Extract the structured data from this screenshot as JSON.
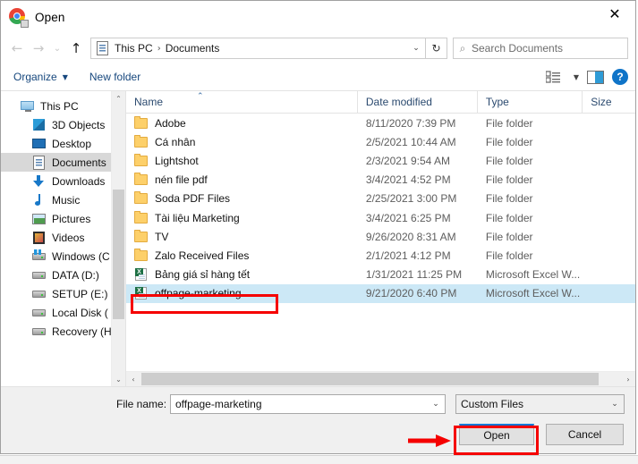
{
  "window": {
    "title": "Open",
    "app_icon": "chrome-icon",
    "close_label": "✕"
  },
  "nav": {
    "back_icon": "←",
    "forward_icon": "→",
    "recent_icon": "⌄",
    "up_icon": "↑",
    "address_icon": "documents-folder-icon",
    "breadcrumbs": [
      "This PC",
      "Documents"
    ],
    "separator": "›",
    "dropdown_caret": "⌄",
    "refresh_icon": "↻"
  },
  "search": {
    "icon": "⌕",
    "placeholder": "Search Documents"
  },
  "command_bar": {
    "organize_label": "Organize",
    "organize_caret": "▼",
    "new_folder_label": "New folder",
    "view_caret": "▼",
    "preview_pane_icon": "preview-pane-icon",
    "help_label": "?"
  },
  "sidebar": {
    "items": [
      {
        "label": "This PC",
        "icon": "pc-icon",
        "level": "root",
        "selected": false
      },
      {
        "label": "3D Objects",
        "icon": "3d-icon",
        "level": "child",
        "selected": false
      },
      {
        "label": "Desktop",
        "icon": "desktop-icon",
        "level": "child",
        "selected": false
      },
      {
        "label": "Documents",
        "icon": "documents-icon",
        "level": "child",
        "selected": true
      },
      {
        "label": "Downloads",
        "icon": "downloads-icon",
        "level": "child",
        "selected": false
      },
      {
        "label": "Music",
        "icon": "music-icon",
        "level": "child",
        "selected": false
      },
      {
        "label": "Pictures",
        "icon": "pictures-icon",
        "level": "child",
        "selected": false
      },
      {
        "label": "Videos",
        "icon": "videos-icon",
        "level": "child",
        "selected": false
      },
      {
        "label": "Windows (C",
        "icon": "windows-drive-icon",
        "level": "child",
        "selected": false
      },
      {
        "label": "DATA (D:)",
        "icon": "drive-icon",
        "level": "child",
        "selected": false
      },
      {
        "label": "SETUP (E:)",
        "icon": "drive-icon",
        "level": "child",
        "selected": false
      },
      {
        "label": "Local Disk (",
        "icon": "drive-icon",
        "level": "child",
        "selected": false
      },
      {
        "label": "Recovery (H",
        "icon": "drive-icon",
        "level": "child",
        "selected": false
      }
    ],
    "scroll_up_icon": "⌃",
    "scroll_down_icon": "⌄"
  },
  "file_list": {
    "columns": [
      "Name",
      "Date modified",
      "Type",
      "Size"
    ],
    "sort_caret": "⌃",
    "rows": [
      {
        "name": "Adobe",
        "date": "8/11/2020 7:39 PM",
        "type": "File folder",
        "size": "",
        "icon": "folder-icon",
        "selected": false
      },
      {
        "name": "Cá nhân",
        "date": "2/5/2021 10:44 AM",
        "type": "File folder",
        "size": "",
        "icon": "folder-icon",
        "selected": false
      },
      {
        "name": "Lightshot",
        "date": "2/3/2021 9:54 AM",
        "type": "File folder",
        "size": "",
        "icon": "folder-icon",
        "selected": false
      },
      {
        "name": "nén file pdf",
        "date": "3/4/2021 4:52 PM",
        "type": "File folder",
        "size": "",
        "icon": "folder-icon",
        "selected": false
      },
      {
        "name": "Soda PDF Files",
        "date": "2/25/2021 3:00 PM",
        "type": "File folder",
        "size": "",
        "icon": "folder-icon",
        "selected": false
      },
      {
        "name": "Tài liệu Marketing",
        "date": "3/4/2021 6:25 PM",
        "type": "File folder",
        "size": "",
        "icon": "folder-icon",
        "selected": false
      },
      {
        "name": "TV",
        "date": "9/26/2020 8:31 AM",
        "type": "File folder",
        "size": "",
        "icon": "folder-icon",
        "selected": false
      },
      {
        "name": "Zalo Received Files",
        "date": "2/1/2021 4:12 PM",
        "type": "File folder",
        "size": "",
        "icon": "folder-icon",
        "selected": false
      },
      {
        "name": "Bảng giá sỉ hàng tết",
        "date": "1/31/2021 11:25 PM",
        "type": "Microsoft Excel W...",
        "size": "",
        "icon": "excel-icon",
        "selected": false
      },
      {
        "name": "offpage-marketing",
        "date": "9/21/2020 6:40 PM",
        "type": "Microsoft Excel W...",
        "size": "",
        "icon": "excel-icon",
        "selected": true
      }
    ],
    "hscroll_left_icon": "‹",
    "hscroll_right_icon": "›"
  },
  "footer": {
    "file_name_label": "File name:",
    "file_name_value": "offpage-marketing",
    "file_name_caret": "⌄",
    "filter_value": "Custom Files",
    "filter_caret": "⌄",
    "open_label": "Open",
    "cancel_label": "Cancel"
  },
  "annotations": {
    "accent_color": "#f50000",
    "highlight_selected_file": true,
    "highlight_open_button": true,
    "arrow_points_to": "Open"
  }
}
